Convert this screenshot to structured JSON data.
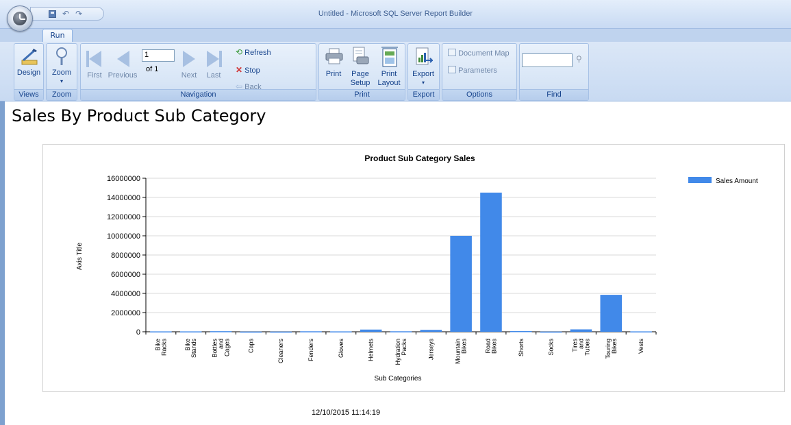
{
  "window": {
    "title": "Untitled - Microsoft SQL Server Report Builder"
  },
  "tabs": [
    {
      "label": "Run"
    }
  ],
  "ribbon": {
    "views": {
      "group_label": "Views",
      "design_label": "Design"
    },
    "zoom": {
      "group_label": "Zoom",
      "zoom_label": "Zoom"
    },
    "navigation": {
      "group_label": "Navigation",
      "first_label": "First",
      "previous_label": "Previous",
      "page_value": "1",
      "of_label": "of 1",
      "next_label": "Next",
      "last_label": "Last",
      "refresh_label": "Refresh",
      "stop_label": "Stop",
      "back_label": "Back"
    },
    "print": {
      "group_label": "Print",
      "print_label": "Print",
      "page_setup_label_1": "Page",
      "page_setup_label_2": "Setup",
      "print_layout_label_1": "Print",
      "print_layout_label_2": "Layout"
    },
    "export": {
      "group_label": "Export",
      "export_label": "Export"
    },
    "options": {
      "group_label": "Options",
      "document_map_label": "Document Map",
      "parameters_label": "Parameters"
    },
    "find": {
      "group_label": "Find",
      "search_value": ""
    }
  },
  "report": {
    "title": "Sales By Product Sub Category",
    "timestamp": "12/10/2015 11:14:19"
  },
  "chart_data": {
    "type": "bar",
    "title": "Product Sub Category Sales",
    "xlabel": "Sub Categories",
    "ylabel": "Axis Title",
    "ylim": [
      0,
      16000000
    ],
    "yticks": [
      0,
      2000000,
      4000000,
      6000000,
      8000000,
      10000000,
      12000000,
      14000000,
      16000000
    ],
    "grid": true,
    "legend_position": "top-right",
    "categories": [
      "Bike Racks",
      "Bike Stands",
      "Bottles and Cages",
      "Caps",
      "Cleaners",
      "Fenders",
      "Gloves",
      "Helmets",
      "Hydration Packs",
      "Jerseys",
      "Mountain Bikes",
      "Road Bikes",
      "Shorts",
      "Socks",
      "Tires and Tubes",
      "Touring Bikes",
      "Vests"
    ],
    "category_lines": [
      [
        "Bike",
        "Racks"
      ],
      [
        "Bike",
        "Stands"
      ],
      [
        "Bottles",
        "and",
        "Cages"
      ],
      [
        "Caps"
      ],
      [
        "Cleaners"
      ],
      [
        "Fenders"
      ],
      [
        "Gloves"
      ],
      [
        "Helmets"
      ],
      [
        "Hydration",
        "Packs"
      ],
      [
        "Jerseys"
      ],
      [
        "Mountain",
        "Bikes"
      ],
      [
        "Road",
        "Bikes"
      ],
      [
        "Shorts"
      ],
      [
        "Socks"
      ],
      [
        "Tires",
        "and",
        "Tubes"
      ],
      [
        "Touring",
        "Bikes"
      ],
      [
        "Vests"
      ]
    ],
    "series": [
      {
        "name": "Sales Amount",
        "color": "#4189e9",
        "values": [
          40000,
          40000,
          60000,
          20000,
          20000,
          50000,
          40000,
          230000,
          50000,
          200000,
          10000000,
          14500000,
          70000,
          20000,
          250000,
          3850000,
          40000
        ]
      }
    ]
  }
}
